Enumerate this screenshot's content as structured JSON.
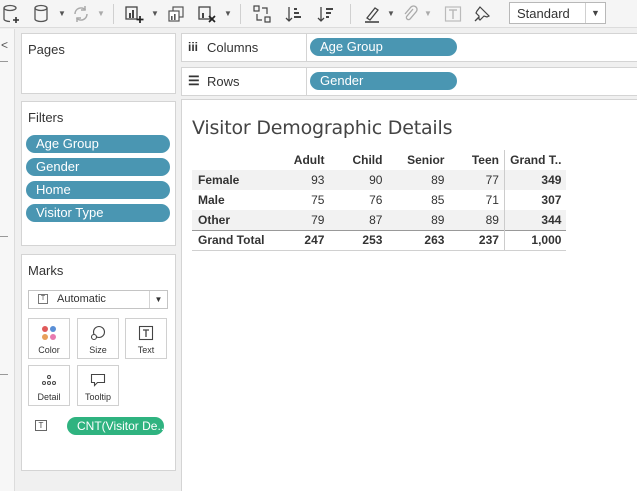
{
  "toolbar": {
    "standard_select": "Standard",
    "icons": [
      "new-datasource-icon",
      "refresh-icon",
      "new-worksheet-icon",
      "duplicate-icon",
      "clear-sheet-icon",
      "swap-icon",
      "sort-ascending-icon",
      "sort-descending-icon",
      "highlight-icon",
      "annotate-icon",
      "label-icon",
      "pin-icon"
    ]
  },
  "pages": {
    "title": "Pages"
  },
  "filters": {
    "title": "Filters",
    "items": [
      "Age Group",
      "Gender",
      "Home",
      "Visitor Type"
    ]
  },
  "marks": {
    "title": "Marks",
    "mark_type": "Automatic",
    "buttons": [
      {
        "label": "Color",
        "icon": "color-icon"
      },
      {
        "label": "Size",
        "icon": "size-icon"
      },
      {
        "label": "Text",
        "icon": "text-icon"
      },
      {
        "label": "Detail",
        "icon": "detail-icon"
      },
      {
        "label": "Tooltip",
        "icon": "tooltip-icon"
      }
    ],
    "field_pill": "CNT(Visitor De.."
  },
  "shelves": {
    "columns_label": "Columns",
    "columns_pill": "Age Group",
    "rows_label": "Rows",
    "rows_pill": "Gender"
  },
  "view": {
    "title": "Visitor Demographic Details",
    "columns": [
      "Adult",
      "Child",
      "Senior",
      "Teen",
      "Grand T.."
    ],
    "rows": [
      {
        "label": "Female",
        "values": [
          "93",
          "90",
          "89",
          "77",
          "349"
        ]
      },
      {
        "label": "Male",
        "values": [
          "75",
          "76",
          "85",
          "71",
          "307"
        ]
      },
      {
        "label": "Other",
        "values": [
          "79",
          "87",
          "89",
          "89",
          "344"
        ]
      }
    ],
    "total": {
      "label": "Grand Total",
      "values": [
        "247",
        "253",
        "263",
        "237",
        "1,000"
      ]
    }
  },
  "colors": {
    "pill_blue": "#4a96b2",
    "pill_green": "#2fb380"
  }
}
